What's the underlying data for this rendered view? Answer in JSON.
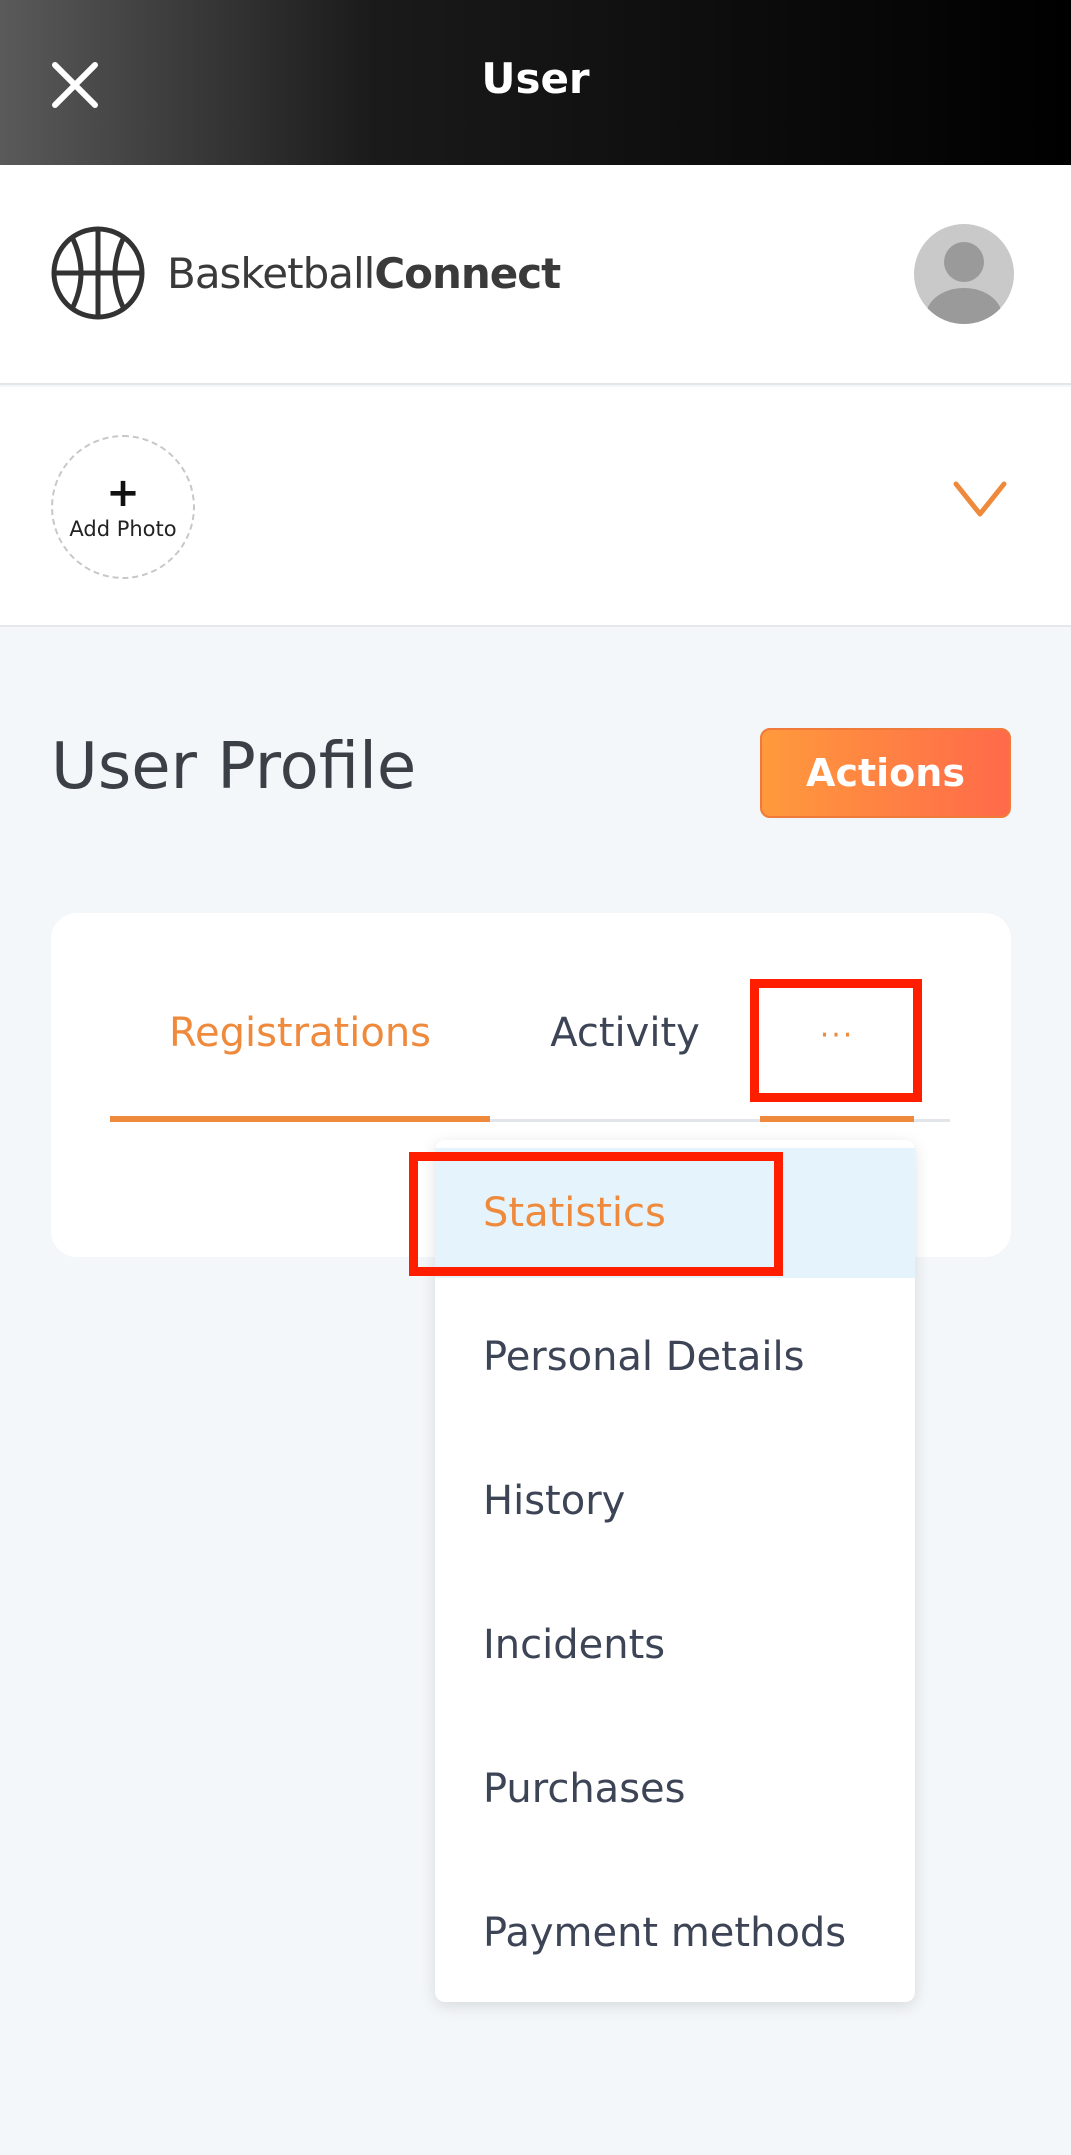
{
  "topbar": {
    "title": "User"
  },
  "brand": {
    "name_light": "Basketball",
    "name_bold": "Connect"
  },
  "photo": {
    "plus": "+",
    "label": "Add Photo"
  },
  "main": {
    "title": "User Profile",
    "actions_label": "Actions"
  },
  "tabs": {
    "registrations": "Registrations",
    "activity": "Activity",
    "more": "···"
  },
  "menu": {
    "items": [
      {
        "label": "Statistics",
        "active": true
      },
      {
        "label": "Personal Details"
      },
      {
        "label": "History"
      },
      {
        "label": "Incidents"
      },
      {
        "label": "Purchases"
      },
      {
        "label": "Payment methods"
      }
    ]
  },
  "colors": {
    "accent": "#ef8a3c",
    "highlight": "#ff1f00",
    "active_item_bg": "#e5f4fc"
  },
  "icons": [
    "close-icon",
    "basketball-logo-icon",
    "avatar-icon",
    "chevron-down-icon"
  ]
}
